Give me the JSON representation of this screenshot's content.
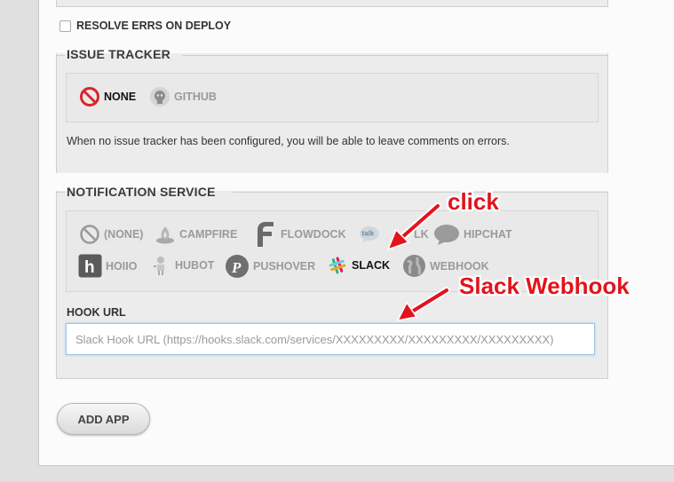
{
  "settings": {
    "resolve_errs_label": "RESOLVE ERRS ON DEPLOY"
  },
  "issue_tracker": {
    "legend": "ISSUE TRACKER",
    "options": [
      {
        "label": "NONE",
        "icon": "no-entry-icon",
        "selected": true
      },
      {
        "label": "GITHUB",
        "icon": "github-octocat-icon",
        "selected": false
      }
    ],
    "note": "When no issue tracker has been configured, you will be able to leave comments on errors."
  },
  "notification_service": {
    "legend": "NOTIFICATION SERVICE",
    "options_row1": [
      {
        "label": "(NONE)",
        "icon": "no-entry-icon"
      },
      {
        "label": "CAMPFIRE",
        "icon": "campfire-icon"
      },
      {
        "label": "FLOWDOCK",
        "icon": "flowdock-icon"
      },
      {
        "label": "LK",
        "icon": "gtalk-icon"
      },
      {
        "label": "HIPCHAT",
        "icon": "hipchat-icon"
      }
    ],
    "options_row2": [
      {
        "label": "HOIIO",
        "icon": "hoiio-icon"
      },
      {
        "label": "HUBOT",
        "icon": "hubot-icon"
      },
      {
        "label": "PUSHOVER",
        "icon": "pushover-icon"
      },
      {
        "label": "SLACK",
        "icon": "slack-icon",
        "selected": true
      },
      {
        "label": "WEBHOOK",
        "icon": "globe-icon"
      }
    ],
    "hook_url_label": "HOOK URL",
    "hook_url_placeholder": "Slack Hook URL (https://hooks.slack.com/services/XXXXXXXXX/XXXXXXXXX/XXXXXXXXX)",
    "hook_url_value": ""
  },
  "actions": {
    "add_app_label": "ADD APP"
  },
  "annotations": {
    "click": "click",
    "slack_webhook": "Slack Webhook",
    "color": "#e3131c"
  }
}
